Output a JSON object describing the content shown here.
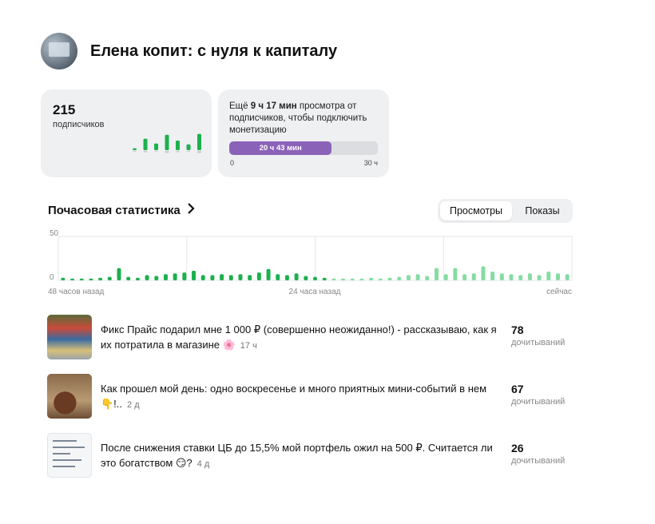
{
  "channel": {
    "title": "Елена копит: с нуля к капиталу"
  },
  "subscribers": {
    "count": "215",
    "label": "подписчиков",
    "mini_chart": [
      0.1,
      0.6,
      0.35,
      0.8,
      0.5,
      0.3,
      0.85
    ]
  },
  "monetization": {
    "text_prefix": "Ещё ",
    "text_bold": "9 ч 17 мин",
    "text_suffix": " просмотра от подписчиков, чтобы подключить монетизацию",
    "progress_label": "20 ч 43 мин",
    "progress_fraction": 0.69,
    "min_label": "0",
    "max_label": "30 ч",
    "color": "#8a63b8"
  },
  "hourly_stats": {
    "title": "Почасовая статистика",
    "tabs": [
      {
        "label": "Просмотры",
        "active": true
      },
      {
        "label": "Показы",
        "active": false
      }
    ]
  },
  "chart_data": {
    "type": "bar",
    "ylim": [
      0,
      50
    ],
    "ytick_labels": [
      "50",
      "0"
    ],
    "xtick_labels": [
      "48 часов назад",
      "24 часа назад",
      "сейчас"
    ],
    "grid": true,
    "colors": {
      "past": "#1db04e",
      "recent": "#86dca3"
    },
    "values": [
      3,
      2,
      2,
      2,
      3,
      4,
      14,
      4,
      3,
      6,
      5,
      7,
      8,
      9,
      11,
      6,
      6,
      7,
      6,
      7,
      6,
      9,
      13,
      7,
      6,
      8,
      5,
      4,
      3,
      2,
      2,
      2,
      2,
      3,
      2,
      3,
      4,
      6,
      7,
      5,
      14,
      7,
      14,
      7,
      8,
      16,
      10,
      8,
      7,
      6,
      8,
      6,
      10,
      8,
      7
    ],
    "recent_from_index": 29
  },
  "posts": [
    {
      "title": "Фикс Прайс подарил мне 1 000 ₽ (совершенно неожиданно!) - рассказываю, как я их потратила в магазине 🌸",
      "age": "17 ч",
      "reads": "78",
      "reads_label": "дочитываний"
    },
    {
      "title": "Как прошел мой день: одно воскресенье и много приятных мини-событий в нем 👇!..",
      "age": "2 д",
      "reads": "67",
      "reads_label": "дочитываний"
    },
    {
      "title": "После снижения ставки ЦБ до 15,5% мой портфель ожил на 500 ₽. Считается ли это богатством 😏?",
      "age": "4 д",
      "reads": "26",
      "reads_label": "дочитываний"
    }
  ]
}
